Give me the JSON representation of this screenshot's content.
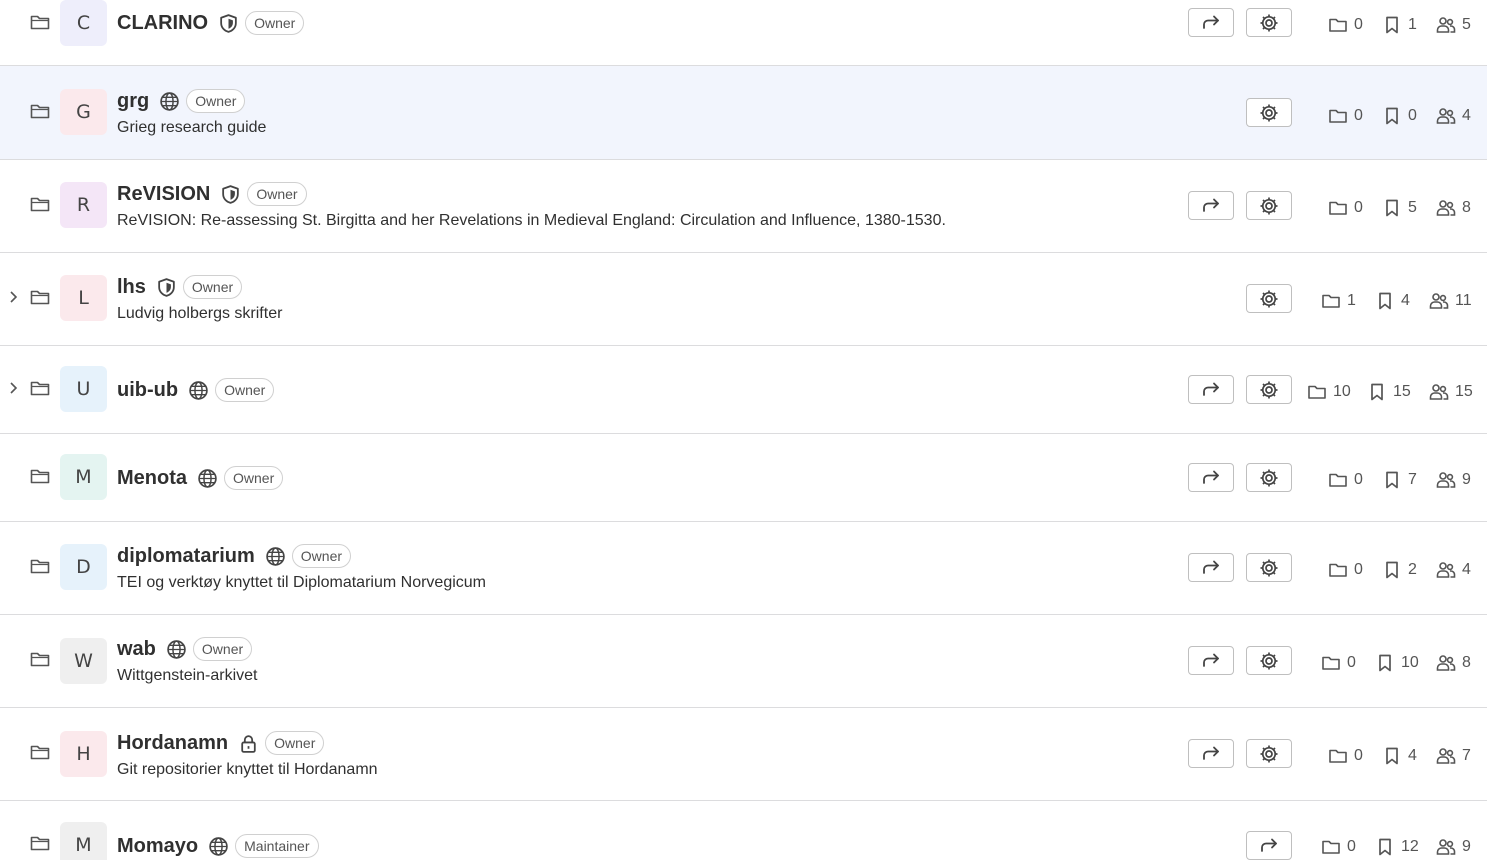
{
  "projects": [
    {
      "name": "CLARINO",
      "visibility": "shield-icon",
      "role": "Owner",
      "description": "",
      "avatar_letter": "C",
      "avatar_color": "#eeeefb",
      "has_share": true,
      "has_settings": true,
      "expandable": false,
      "highlight": false,
      "stats": {
        "subgroups": "0",
        "projects": "1",
        "members": "5"
      }
    },
    {
      "name": "grg",
      "visibility": "globe-icon",
      "role": "Owner",
      "description": "Grieg research guide",
      "avatar_letter": "G",
      "avatar_color": "#fbe9ec",
      "has_share": false,
      "has_settings": true,
      "expandable": false,
      "highlight": true,
      "stats": {
        "subgroups": "0",
        "projects": "0",
        "members": "4"
      }
    },
    {
      "name": "ReVISION",
      "visibility": "shield-icon",
      "role": "Owner",
      "description": "ReVISION: Re-assessing St. Birgitta and her Revelations in Medieval England: Circulation and Influence, 1380-1530.",
      "avatar_letter": "R",
      "avatar_color": "#f4e6f7",
      "has_share": true,
      "has_settings": true,
      "expandable": false,
      "highlight": false,
      "stats": {
        "subgroups": "0",
        "projects": "5",
        "members": "8"
      }
    },
    {
      "name": "lhs",
      "visibility": "shield-icon",
      "role": "Owner",
      "description": "Ludvig holbergs skrifter",
      "avatar_letter": "L",
      "avatar_color": "#fbe9ec",
      "has_share": false,
      "has_settings": true,
      "expandable": true,
      "highlight": false,
      "stats": {
        "subgroups": "1",
        "projects": "4",
        "members": "11"
      }
    },
    {
      "name": "uib-ub",
      "visibility": "globe-icon",
      "role": "Owner",
      "description": "",
      "avatar_letter": "U",
      "avatar_color": "#e6f2fb",
      "has_share": true,
      "has_settings": true,
      "expandable": true,
      "highlight": false,
      "stats": {
        "subgroups": "10",
        "projects": "15",
        "members": "15"
      }
    },
    {
      "name": "Menota",
      "visibility": "globe-icon",
      "role": "Owner",
      "description": "",
      "avatar_letter": "M",
      "avatar_color": "#e4f4f1",
      "has_share": true,
      "has_settings": true,
      "expandable": false,
      "highlight": false,
      "stats": {
        "subgroups": "0",
        "projects": "7",
        "members": "9"
      }
    },
    {
      "name": "diplomatarium",
      "visibility": "globe-icon",
      "role": "Owner",
      "description": "TEI og verktøy knyttet til Diplomatarium Norvegicum",
      "avatar_letter": "D",
      "avatar_color": "#e6f2fb",
      "has_share": true,
      "has_settings": true,
      "expandable": false,
      "highlight": false,
      "stats": {
        "subgroups": "0",
        "projects": "2",
        "members": "4"
      }
    },
    {
      "name": "wab",
      "visibility": "globe-icon",
      "role": "Owner",
      "description": "Wittgenstein-arkivet",
      "avatar_letter": "W",
      "avatar_color": "#efefef",
      "has_share": true,
      "has_settings": true,
      "expandable": false,
      "highlight": false,
      "stats": {
        "subgroups": "0",
        "projects": "10",
        "members": "8"
      }
    },
    {
      "name": "Hordanamn",
      "visibility": "lock-icon",
      "role": "Owner",
      "description": "Git repositorier knyttet til Hordanamn",
      "avatar_letter": "H",
      "avatar_color": "#fbe9ec",
      "has_share": true,
      "has_settings": true,
      "expandable": false,
      "highlight": false,
      "stats": {
        "subgroups": "0",
        "projects": "4",
        "members": "7"
      }
    },
    {
      "name": "Momayo",
      "visibility": "globe-icon",
      "role": "Maintainer",
      "description": "",
      "avatar_letter": "M",
      "avatar_color": "#efefef",
      "has_share": true,
      "has_settings": false,
      "expandable": false,
      "highlight": false,
      "stats": {
        "subgroups": "0",
        "projects": "12",
        "members": "9"
      }
    }
  ]
}
